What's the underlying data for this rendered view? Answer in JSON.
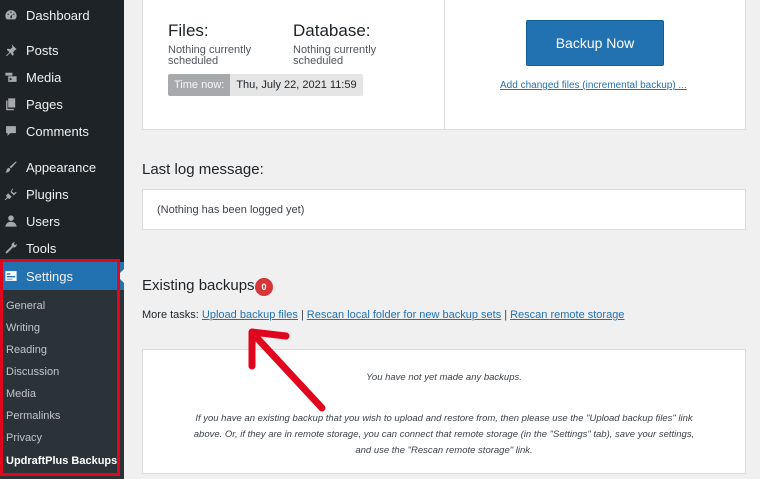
{
  "sidebar": {
    "items": [
      {
        "label": "Dashboard",
        "icon": "dashboard-icon"
      },
      {
        "label": "Posts",
        "icon": "pin-icon"
      },
      {
        "label": "Media",
        "icon": "media-icon"
      },
      {
        "label": "Pages",
        "icon": "pages-icon"
      },
      {
        "label": "Comments",
        "icon": "comment-icon"
      },
      {
        "label": "Appearance",
        "icon": "brush-icon"
      },
      {
        "label": "Plugins",
        "icon": "plug-icon"
      },
      {
        "label": "Users",
        "icon": "user-icon"
      },
      {
        "label": "Tools",
        "icon": "wrench-icon"
      },
      {
        "label": "Settings",
        "icon": "settings-icon"
      }
    ],
    "submenu": [
      "General",
      "Writing",
      "Reading",
      "Discussion",
      "Media",
      "Permalinks",
      "Privacy",
      "UpdraftPlus Backups"
    ]
  },
  "schedule": {
    "files_label": "Files:",
    "files_line1": "Nothing currently",
    "files_line2": "scheduled",
    "db_label": "Database:",
    "db_line1": "Nothing currently",
    "db_line2": "scheduled",
    "time_now_label": "Time now:",
    "time_now_value": "Thu, July 22, 2021 11:59"
  },
  "actions": {
    "backup_now": "Backup Now",
    "incremental_link": "Add changed files (incremental backup) ..."
  },
  "log": {
    "title": "Last log message:",
    "message": "(Nothing has been logged yet)"
  },
  "existing": {
    "title": "Existing backups",
    "count": "0",
    "more_tasks_label": "More tasks:",
    "upload_link": "Upload backup files",
    "rescan_local_link": "Rescan local folder for new backup sets",
    "rescan_remote_link": "Rescan remote storage",
    "separator": "|",
    "empty_message": "You have not yet made any backups.",
    "help_line1": "If you have an existing backup that you wish to upload and restore from, then please use the \"Upload backup files\" link",
    "help_line2": "above. Or, if they are in remote storage, you can connect that remote storage (in the \"Settings\" tab), save your settings,",
    "help_line3": "and use the \"Rescan remote storage\" link."
  },
  "colors": {
    "annotation": "#e0061e",
    "accent": "#2271b1"
  }
}
